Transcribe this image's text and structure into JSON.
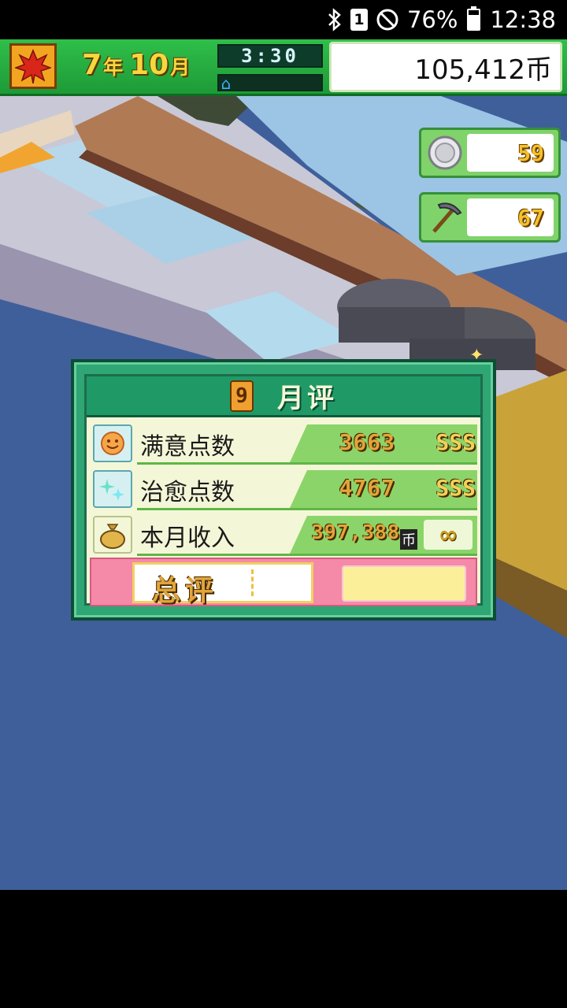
{
  "status_bar": {
    "bluetooth_icon": "bluetooth-icon",
    "sim_label": "1",
    "dnd_icon": "do-not-disturb-icon",
    "battery_percent": "76%",
    "battery_level": 0.76,
    "time": "12:38"
  },
  "hud": {
    "season_icon": "autumn-maple-leaf-icon",
    "year": "7",
    "year_unit": "年",
    "month": "10",
    "month_unit": "月",
    "clock": "3:30",
    "day_progress": 0.0,
    "money": "105,412币"
  },
  "resources": {
    "medals": {
      "icon": "silver-medal-icon",
      "value": "59"
    },
    "research": {
      "icon": "pickaxe-icon",
      "value": "67"
    }
  },
  "evaluation": {
    "month": "9",
    "title": "月评",
    "rows": [
      {
        "icon": "smiley-face-icon",
        "label": "满意点数",
        "value": "3663",
        "grade": "SSS"
      },
      {
        "icon": "sparkle-icon",
        "label": "治愈点数",
        "value": "4767",
        "grade": "SSS"
      },
      {
        "icon": "money-bag-icon",
        "label": "本月收入",
        "value": "397,388",
        "currency": "币",
        "grade": "∞"
      }
    ],
    "total_label": "总评",
    "total_grade": ""
  },
  "colors": {
    "hud_green": "#1e9a37",
    "dialog_green": "#2fa673",
    "water_blue": "#3f5f9b",
    "gold_text": "#e0a63a",
    "total_pink": "#f58aa8"
  }
}
